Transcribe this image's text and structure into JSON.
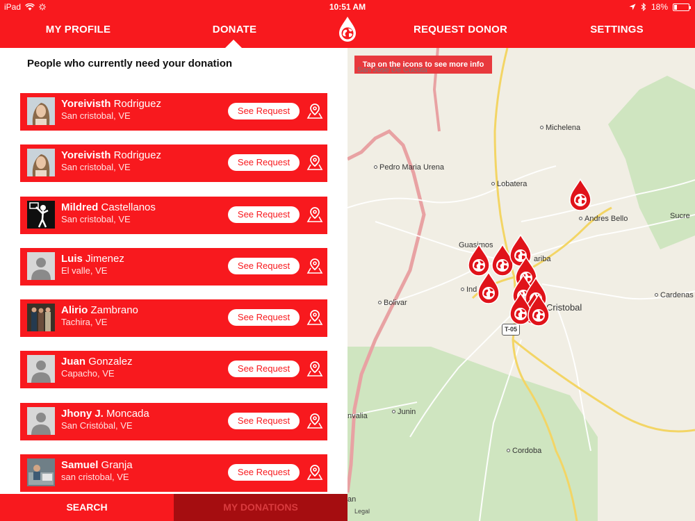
{
  "status_bar": {
    "device": "iPad",
    "time": "10:51 AM",
    "battery": "18%",
    "battery_level": 0.18
  },
  "nav": {
    "my_profile": "MY PROFILE",
    "donate": "DONATE",
    "request_donor": "REQUEST DONOR",
    "settings": "SETTINGS",
    "active": "DONATE"
  },
  "panel": {
    "title": "People who currently need your donation"
  },
  "requests": [
    {
      "first": "Yoreivisth",
      "last": "Rodriguez",
      "location": "San cristobal, VE",
      "button": "See Request",
      "avatar": "woman-photo"
    },
    {
      "first": "Yoreivisth",
      "last": "Rodriguez",
      "location": "San cristobal, VE",
      "button": "See Request",
      "avatar": "woman-photo"
    },
    {
      "first": "Mildred",
      "last": "Castellanos",
      "location": "San cristobal, VE",
      "button": "See Request",
      "avatar": "basketball-photo"
    },
    {
      "first": "Luis",
      "last": "Jimenez",
      "location": "El valle, VE",
      "button": "See Request",
      "avatar": "placeholder"
    },
    {
      "first": "Alirio",
      "last": "Zambrano",
      "location": "Tachira, VE",
      "button": "See Request",
      "avatar": "group-photo"
    },
    {
      "first": "Juan",
      "last": "Gonzalez",
      "location": "Capacho, VE",
      "button": "See Request",
      "avatar": "placeholder"
    },
    {
      "first": "Jhony J.",
      "last": "Moncada",
      "location": "San Cristóbal, VE",
      "button": "See Request",
      "avatar": "placeholder"
    },
    {
      "first": "Samuel",
      "last": "Granja",
      "location": "san cristobal, VE",
      "button": "See Request",
      "avatar": "desk-photo"
    }
  ],
  "bottom_tabs": {
    "search": "SEARCH",
    "my_donations": "MY DONATIONS"
  },
  "map": {
    "hint": "Tap on the icons to see more info",
    "road_shield": "T-05",
    "legal": "Legal",
    "places": {
      "san_jose": "San Jose De Cucuta",
      "michelena": "Michelena",
      "pedro_maria_urena": "Pedro Maria Urena",
      "lobatera": "Lobatera",
      "andres_bello": "Andres Bello",
      "sucre": "Sucre",
      "guasimos": "Guasimos",
      "taribas": "ariba",
      "independencia": "Ind",
      "bolivar": "Bolivar",
      "san_cristobal": "Cristobal",
      "cardenas": "Cardenas",
      "junin": "Junin",
      "cordoba": "Cordoba",
      "uribante": "nvalia",
      "edge_an": "an"
    }
  },
  "colors": {
    "brand_red": "#f8191e",
    "dark_red": "#a50d10",
    "map_bg": "#f1eee4",
    "park_green": "#cfe5c0",
    "major_road": "#f3d565",
    "border_pink": "#e8a2a3"
  }
}
